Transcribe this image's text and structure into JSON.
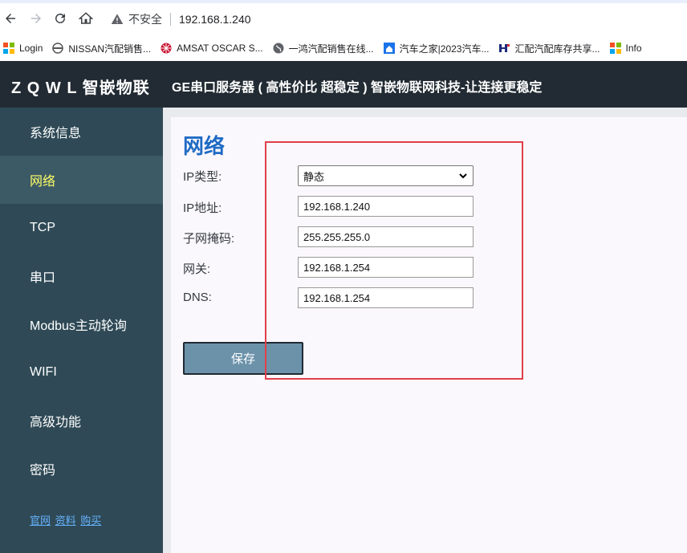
{
  "browser": {
    "insecure_label": "不安全",
    "url": "192.168.1.240",
    "bookmarks": [
      {
        "label": "Login",
        "icon": "ms-grid-icon"
      },
      {
        "label": "NISSAN汽配销售...",
        "icon": "nissan-icon"
      },
      {
        "label": "AMSAT OSCAR S...",
        "icon": "amsat-icon"
      },
      {
        "label": "一鸿汽配销售在线...",
        "icon": "globe-icon"
      },
      {
        "label": "汽车之家|2023汽车...",
        "icon": "autohome-icon"
      },
      {
        "label": "汇配汽配库存共享...",
        "icon": "hp-icon"
      },
      {
        "label": "Info",
        "icon": "ms-grid-icon"
      }
    ]
  },
  "header": {
    "brand": "Z Q W L 智嵌物联",
    "title": "GE串口服务器 ( 高性价比 超稳定 ) 智嵌物联网科技-让连接更稳定"
  },
  "sidebar": {
    "items": [
      {
        "label": "系统信息"
      },
      {
        "label": "网络"
      },
      {
        "label": "TCP"
      },
      {
        "label": "串口"
      },
      {
        "label": "Modbus主动轮询"
      },
      {
        "label": "WIFI"
      },
      {
        "label": "高级功能"
      },
      {
        "label": "密码"
      }
    ],
    "links": [
      "官网",
      "资料",
      "购买"
    ]
  },
  "page": {
    "title": "网络",
    "fields": [
      {
        "label": "IP类型:",
        "value": "静态"
      },
      {
        "label": "IP地址:",
        "value": "192.168.1.240"
      },
      {
        "label": "子网掩码:",
        "value": "255.255.255.0"
      },
      {
        "label": "网关:",
        "value": "192.168.1.254"
      },
      {
        "label": "DNS:",
        "value": "192.168.1.254"
      }
    ],
    "save_label": "保存"
  },
  "colors": {
    "header_bg": "#222b33",
    "sidebar_bg": "#2f4a56",
    "active_item_text": "#ffff66",
    "title_blue": "#1f6bc4",
    "highlight_red": "#e0404a"
  }
}
